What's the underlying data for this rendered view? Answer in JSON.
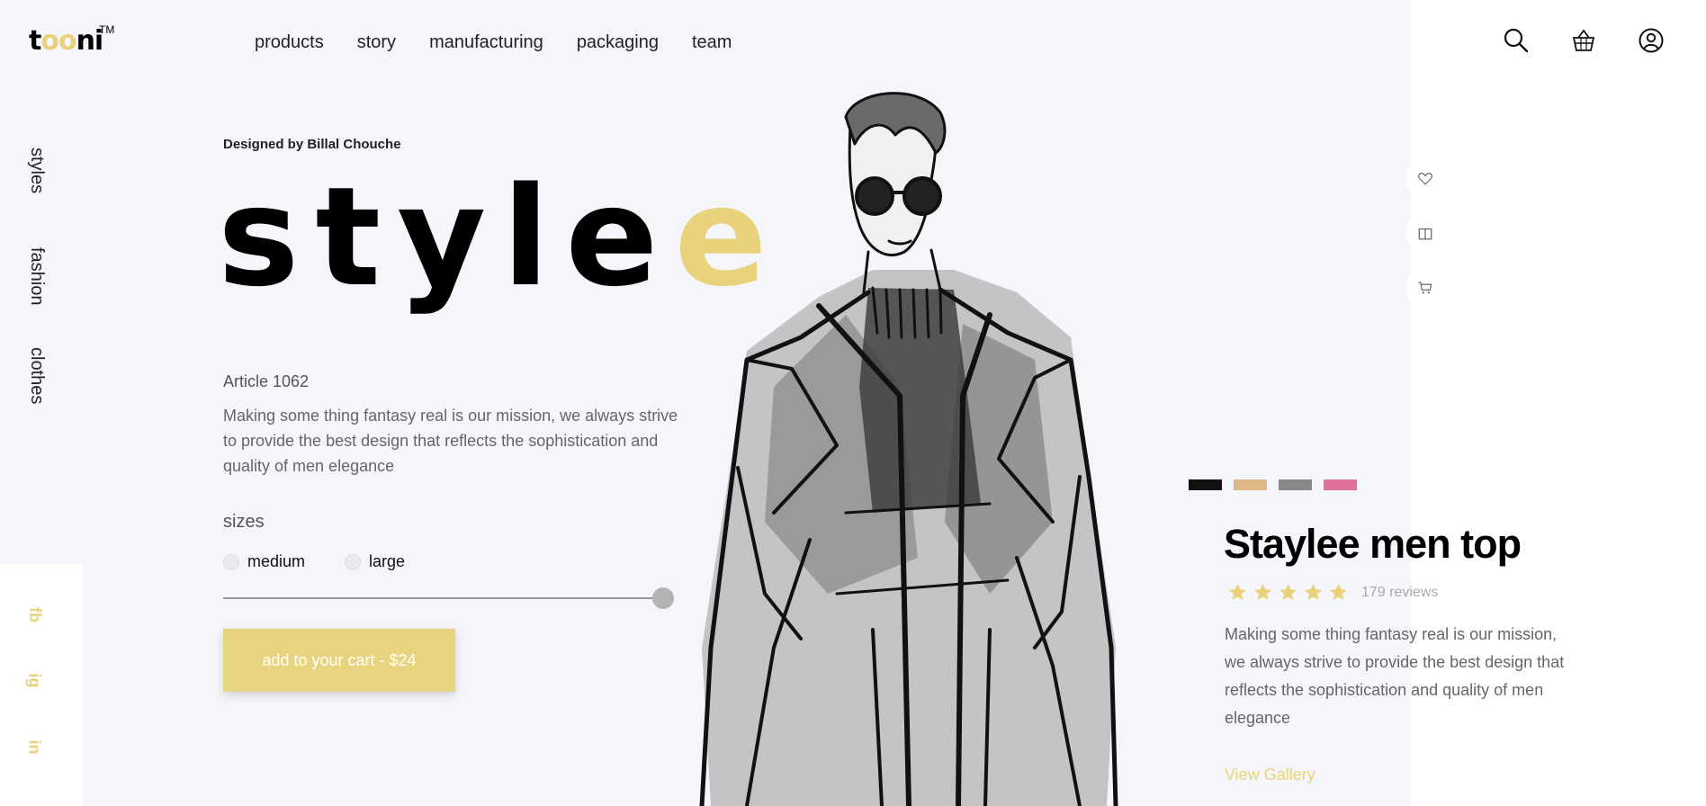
{
  "logo": {
    "text_start": "t",
    "text_highlight": "oo",
    "text_end": "ni",
    "trademark": "TM"
  },
  "nav": {
    "items": [
      "products",
      "story",
      "manufacturing",
      "packaging",
      "team"
    ]
  },
  "header_icons": [
    "search-icon",
    "basket-icon",
    "user-icon"
  ],
  "side_nav": {
    "items": [
      "styles",
      "fashion",
      "clothes"
    ]
  },
  "social": {
    "items": [
      "fb",
      "ig",
      "in"
    ]
  },
  "hero": {
    "designed_by": "Designed by Billal Chouche",
    "title_main": "style",
    "title_highlight": "e"
  },
  "article": {
    "number": "Article 1062",
    "description": "Making some thing fantasy real is our mission, we always strive to provide the best design that reflects the sophistication and quality of men elegance"
  },
  "sizes": {
    "label": "sizes",
    "options": [
      "medium",
      "large"
    ]
  },
  "cart_button": "add to your cart - $24",
  "side_actions": [
    "heart-icon",
    "gift-icon",
    "cart-icon"
  ],
  "swatches": [
    "#111111",
    "#deb887",
    "#888888",
    "#e0709a"
  ],
  "product": {
    "title": "Staylee men top",
    "rating": 5,
    "reviews": "179 reviews",
    "description": "Making some thing fantasy real is our mission, we always strive to provide the best design that reflects the sophistication and quality of men elegance",
    "gallery_link": "View Gallery"
  },
  "background_word": "stylee",
  "colors": {
    "accent": "#e8d27c",
    "background": "#f5f6fb",
    "panel": "#ffffff"
  }
}
